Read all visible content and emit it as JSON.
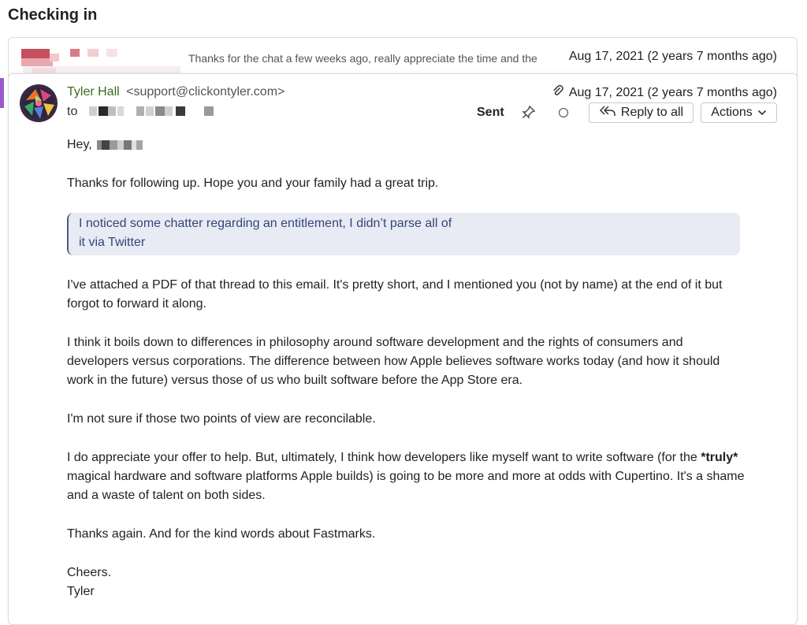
{
  "thread": {
    "title": "Checking in"
  },
  "collapsed_message": {
    "snippet": "Thanks for the chat a few weeks ago, really appreciate the time and the",
    "date": "Aug 17, 2021 (2 years 7 months ago)"
  },
  "message": {
    "sender_name": "Tyler Hall",
    "sender_email": "<support@clickontyler.com>",
    "to_label": "to",
    "date": "Aug 17, 2021 (2 years 7 months ago)",
    "status": "Sent",
    "reply_all_label": "Reply to all",
    "actions_label": "Actions",
    "greeting": "Hey,",
    "paragraphs": {
      "p1": "Thanks for following up. Hope you and your family had a great trip.",
      "quote_line1": "I noticed some chatter regarding an entitlement, I didn’t parse all of",
      "quote_line2": "it via Twitter",
      "p2": "I've attached a PDF of that thread to this email. It's pretty short, and I mentioned you (not by name) at the end of it but forgot to forward it along.",
      "p3": "I think it boils down to differences in philosophy around software development and the rights of consumers and developers versus corporations. The difference between how Apple believes software works today (and how it should work in the future) versus those of us who built software before the App Store era.",
      "p4": "I'm not sure if those two points of view are reconcilable.",
      "p5_before": "I do appreciate your offer to help. But, ultimately, I think how developers like myself want to write software (for the ",
      "p5_bold": "*truly*",
      "p5_after": " magical hardware and software platforms Apple builds) is going to be more and more at odds with Cupertino. It's a shame and a waste of talent on both sides.",
      "p6": "Thanks again. And for the kind words about Fastmarks.",
      "signoff": "Cheers.",
      "signature": "Tyler"
    }
  },
  "colors": {
    "sender_green": "#3a6b1f",
    "quote_bg": "#e8ebf3",
    "quote_text": "#34457a",
    "accent_purple": "#9b59d0"
  },
  "icons": {
    "attachment": "paperclip-icon",
    "pin": "pin-icon",
    "unread": "circle-icon",
    "reply_all": "reply-all-icon",
    "dropdown": "chevron-down-icon"
  }
}
